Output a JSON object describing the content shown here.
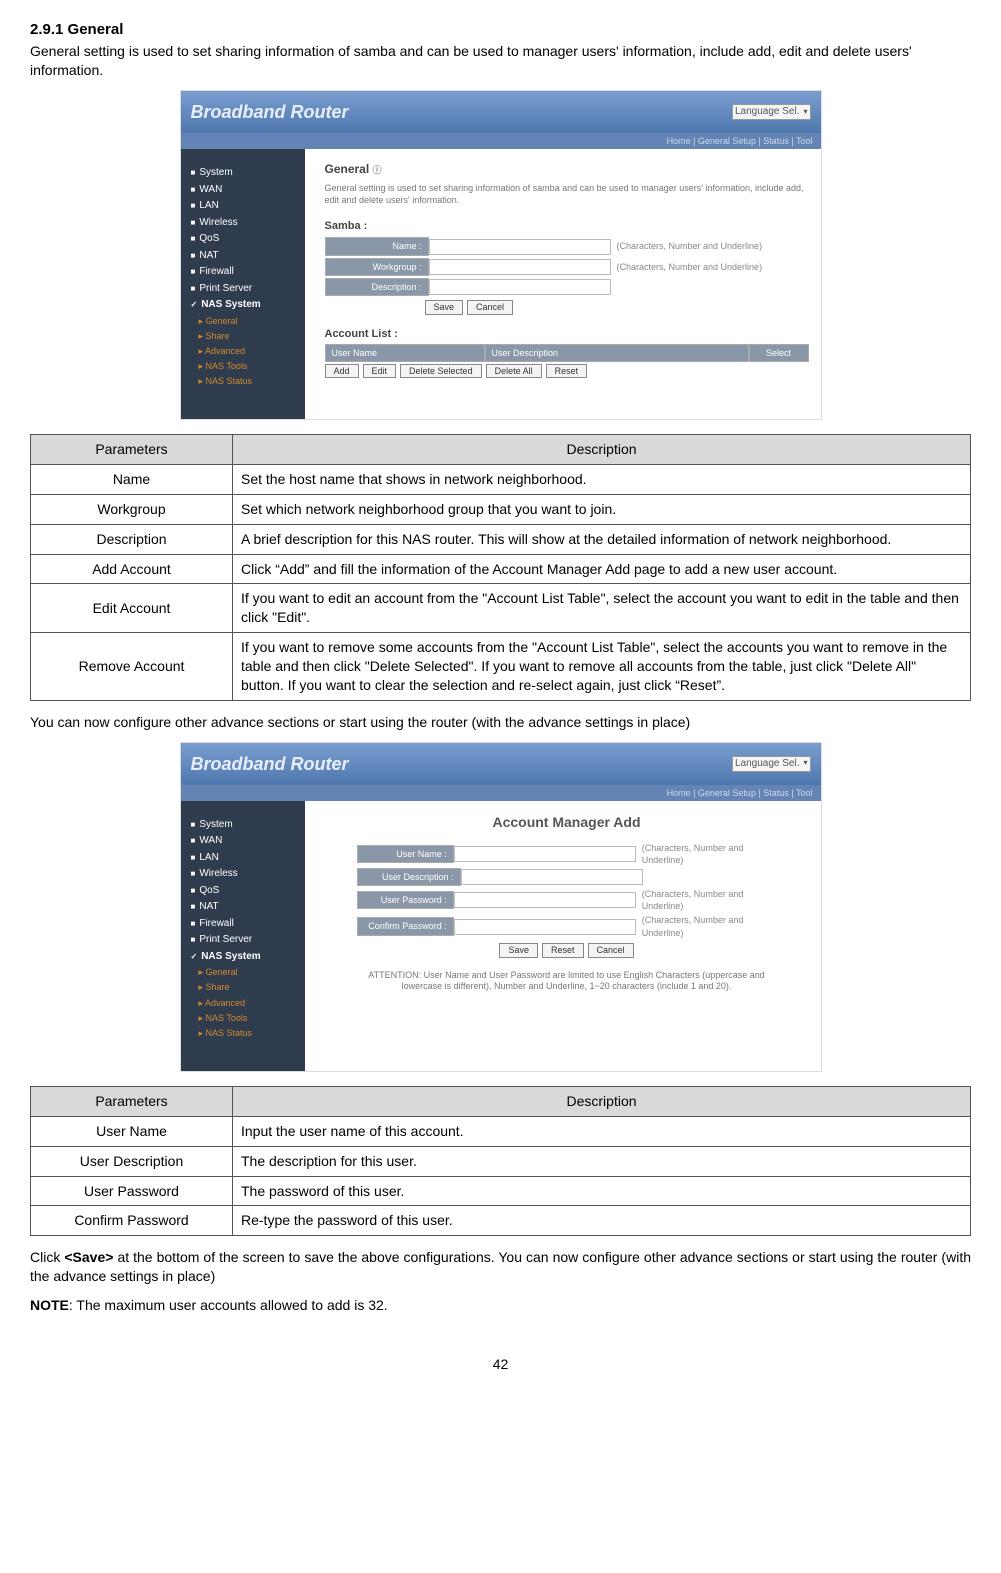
{
  "section": {
    "number_title": "2.9.1 General",
    "intro": "General setting is used to set sharing information of samba and can be used to manager users' information, include add, edit and delete users' information."
  },
  "shot1": {
    "title": "Broadband Router",
    "langsel": "Language Sel.",
    "subtabs": "Home | General Setup | Status | Tool",
    "sidebar": [
      "System",
      "WAN",
      "LAN",
      "Wireless",
      "QoS",
      "NAT",
      "Firewall",
      "Print Server"
    ],
    "sidebar_active": "NAS System",
    "sidebar_sub": [
      "General",
      "Share",
      "Advanced",
      "NAS Tools",
      "NAS Status"
    ],
    "main_heading": "General ",
    "main_desc": "General setting is used to set sharing information of samba and can be used to manager users' information, include add, edit and delete users' information.",
    "samba_label": "Samba :",
    "fields": {
      "name": "Name :",
      "workgroup": "Workgroup :",
      "description": "Description :",
      "hint": "(Characters, Number and Underline)"
    },
    "btn_save": "Save",
    "btn_cancel": "Cancel",
    "account_list_label": "Account List :",
    "acct_cols": {
      "c1": "User Name",
      "c2": "User Description",
      "c3": "Select"
    },
    "btns": {
      "add": "Add",
      "edit": "Edit",
      "delsel": "Delete Selected",
      "delall": "Delete All",
      "reset": "Reset"
    }
  },
  "table1": {
    "h_param": "Parameters",
    "h_desc": "Description",
    "rows": [
      {
        "p": "Name",
        "d": "Set the host name that shows in network neighborhood."
      },
      {
        "p": "Workgroup",
        "d": "Set which network neighborhood group that you want to join."
      },
      {
        "p": "Description",
        "d": "A brief description for this NAS router. This will show at the detailed information of network neighborhood."
      },
      {
        "p": "Add Account",
        "d": "Click “Add” and fill the information of the Account Manager Add page to add a new user account."
      },
      {
        "p": "Edit Account",
        "d": "If you want to edit an account from the \"Account List Table\", select the account you want to edit in the table and then click \"Edit\"."
      },
      {
        "p": "Remove Account",
        "d": "If you want to remove some accounts from the \"Account List Table\", select the accounts you want to remove in the table and then click \"Delete Selected\". If you want to remove all accounts from the table, just click \"Delete All\" button. If you want to clear the selection and re-select again, just click “Reset”."
      }
    ]
  },
  "mid_para": "You can now configure other advance sections or start using the router (with the advance settings in place)",
  "shot2": {
    "title": "Broadband Router",
    "subtitle": "Account Manager Add",
    "fields": {
      "uname": "User Name :",
      "udesc": "User Description :",
      "upwd": "User Password :",
      "cpwd": "Confirm Password :",
      "hint": "(Characters, Number and Underline)"
    },
    "btns": {
      "save": "Save",
      "reset": "Reset",
      "cancel": "Cancel"
    },
    "attention": "ATTENTION: User Name and User Password are limited to use English Characters (uppercase and lowercase is different), Number and Underline, 1~20 characters (include 1 and 20)."
  },
  "table2": {
    "h_param": "Parameters",
    "h_desc": "Description",
    "rows": [
      {
        "p": "User Name",
        "d": "Input the user name of this account."
      },
      {
        "p": "User Description",
        "d": "The description for this user."
      },
      {
        "p": "User Password",
        "d": "The password of this user."
      },
      {
        "p": "Confirm Password",
        "d": "Re-type the password of this user."
      }
    ]
  },
  "closing": {
    "save_para_pre": "Click ",
    "save_bold": "<Save>",
    "save_para_post": " at the bottom of the screen to save the above configurations. You can now configure other advance sections or start using the router (with the advance settings in place)",
    "note_bold": "NOTE",
    "note_rest": ": The maximum user accounts allowed to add is 32."
  },
  "page_number": "42"
}
